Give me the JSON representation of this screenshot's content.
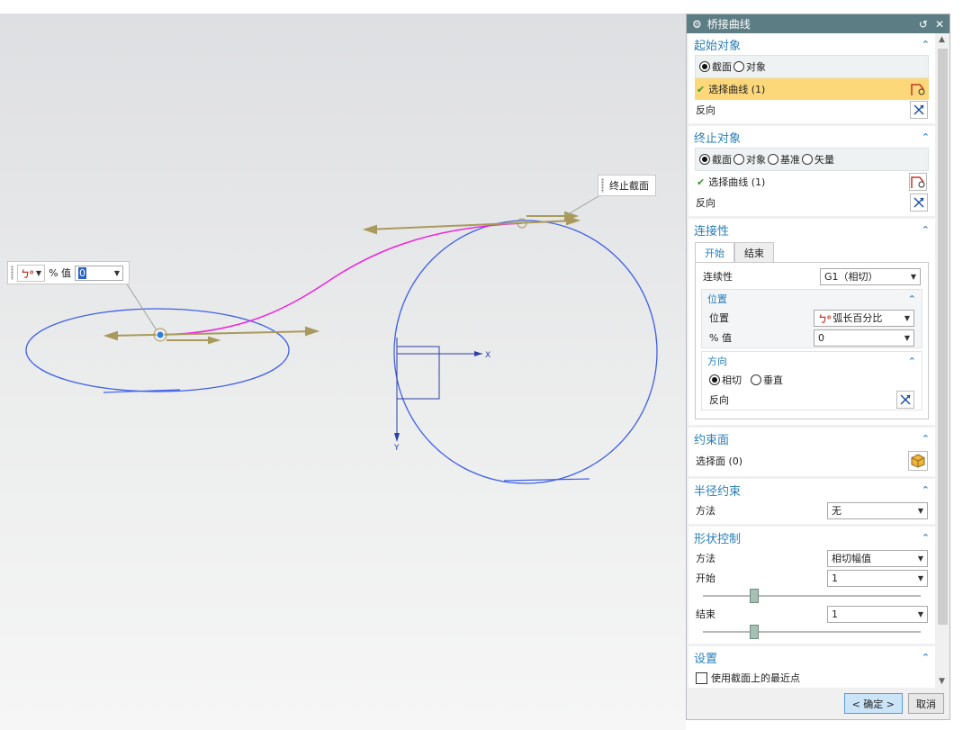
{
  "viewport": {
    "end_section_tooltip": "终止截面",
    "value_box": {
      "label": "% 值",
      "value": "0"
    },
    "axes": {
      "x": "X",
      "y": "Y"
    }
  },
  "dialog": {
    "title": "桥接曲线",
    "start_object": {
      "title": "起始对象",
      "radios": [
        "截面",
        "对象"
      ],
      "selected": "截面",
      "select_label": "选择曲线 (1)",
      "reverse": "反向"
    },
    "end_object": {
      "title": "终止对象",
      "radios": [
        "截面",
        "对象",
        "基准",
        "矢量"
      ],
      "selected": "截面",
      "select_label": "选择曲线 (1)",
      "reverse": "反向"
    },
    "continuity": {
      "title": "连接性",
      "tabs": [
        "开始",
        "结束"
      ],
      "active_tab": "开始",
      "continuity_label": "连续性",
      "continuity_value": "G1（相切）",
      "position": {
        "title": "位置",
        "position_label": "位置",
        "position_value": "弧长百分比",
        "percent_label": "% 值",
        "percent_value": "0"
      },
      "direction": {
        "title": "方向",
        "radios": [
          "相切",
          "垂直"
        ],
        "selected": "相切",
        "reverse": "反向"
      }
    },
    "constraint_face": {
      "title": "约束面",
      "select_label": "选择面 (0)"
    },
    "radius_constraint": {
      "title": "半径约束",
      "method_label": "方法",
      "method_value": "无"
    },
    "shape_control": {
      "title": "形状控制",
      "method_label": "方法",
      "method_value": "相切幅值",
      "start_label": "开始",
      "start_value": "1",
      "end_label": "结束",
      "end_value": "1",
      "start_slider": 0.5,
      "end_slider": 0.5
    },
    "settings": {
      "title": "设置",
      "checkbox_label": "使用截面上的最近点",
      "checked": false
    },
    "buttons": {
      "ok": "< 确定 >",
      "cancel": "取消"
    }
  },
  "colors": {
    "titlebar": "#5d7d85",
    "section_title": "#2a7fb7",
    "curve": "#4060e8",
    "bridge": "#ee22dd",
    "arrow": "#a89a5c",
    "highlight": "#fdd87a"
  }
}
